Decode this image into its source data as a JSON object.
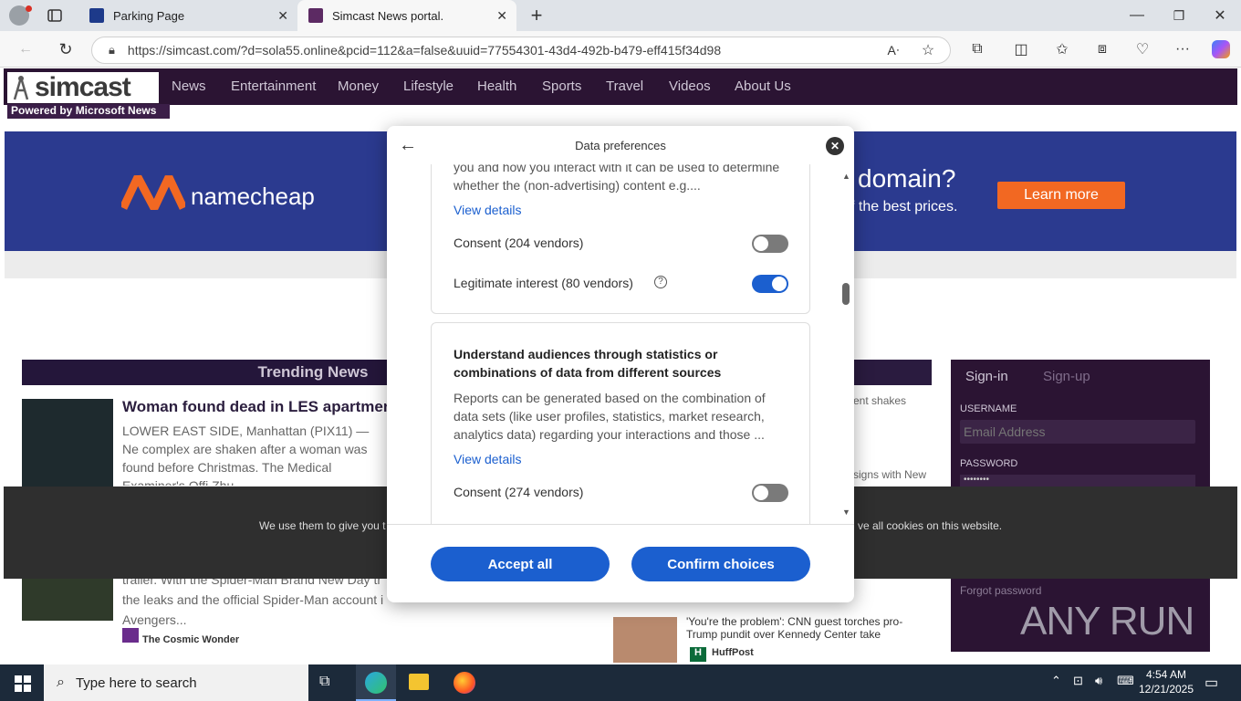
{
  "browser": {
    "tabs": [
      {
        "title": "Parking Page"
      },
      {
        "title": "Simcast News portal."
      }
    ],
    "url": "https://simcast.com/?d=sola55.online&pcid=112&a=false&uuid=77554301-43d4-492b-b479-eff415f34d98"
  },
  "site": {
    "logo_text": "simcast",
    "powered_by": "Powered by Microsoft News",
    "nav": [
      "News",
      "Entertainment",
      "Money",
      "Lifestyle",
      "Health",
      "Sports",
      "Travel",
      "Videos",
      "About Us"
    ],
    "ad": {
      "brand": "namecheap",
      "headline": "domain?",
      "subline": "f the best prices.",
      "cta": "Learn more"
    },
    "trending_title": "Trending News",
    "articles": [
      {
        "title": "Woman found dead in LES apartment",
        "excerpt": "LOWER EAST SIDE, Manhattan (PIX11) — Ne complex are shaken after a woman was found before Christmas. The Medical Examiner's Offi Zhu"
      },
      {
        "excerpt": "trailer. With the Spider-Man Brand New Day tr the leaks and the official Spider-Man account i Avengers...",
        "source": "The Cosmic Wonder"
      }
    ],
    "right_items": [
      {
        "text": "ent shakes"
      },
      {
        "text": "signs with New"
      },
      {
        "title": "'You're the problem': CNN guest torches pro-Trump pundit over Kennedy Center take",
        "source": "HuffPost"
      }
    ],
    "signin": {
      "tab_signin": "Sign-in",
      "tab_signup": "Sign-up",
      "username_label": "USERNAME",
      "email_placeholder": "Email Address",
      "password_label": "PASSWORD",
      "password_mask": "••••••••",
      "forgot": "Forgot password"
    },
    "cookie_text_left": "We use them to give you t",
    "cookie_text_right": "ve all cookies on this website."
  },
  "modal": {
    "title": "Data preferences",
    "card1": {
      "desc": "you and how you interact with it can be used to determine whether the (non-advertising) content e.g....",
      "view_details": "View details",
      "consent": "Consent (204 vendors)",
      "consent_on": false,
      "legit": "Legitimate interest (80 vendors)",
      "legit_on": true
    },
    "card2": {
      "title": "Understand audiences through statistics or combinations of data from different sources",
      "desc": "Reports can be generated based on the combination of data sets (like user profiles, statistics, market research, analytics data) regarding your interactions and those ...",
      "view_details": "View details",
      "consent": "Consent (274 vendors)",
      "consent_on": false
    },
    "accept_all": "Accept all",
    "confirm": "Confirm choices",
    "colors": {
      "accent": "#1b5fcf",
      "toggle_off": "#7a7a7a"
    }
  },
  "taskbar": {
    "search_placeholder": "Type here to search",
    "time": "4:54 AM",
    "date": "12/21/2025"
  },
  "watermark": "ANY RUN"
}
